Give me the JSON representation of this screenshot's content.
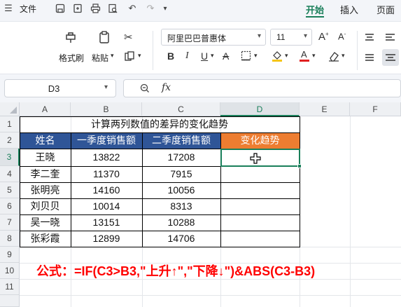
{
  "menu": {
    "file_label": "文件",
    "tabs": [
      "开始",
      "插入",
      "页面"
    ]
  },
  "ribbon": {
    "format_painter": "格式刷",
    "paste": "粘贴",
    "font_name": "阿里巴巴普惠体",
    "font_size": "11"
  },
  "formula_bar": {
    "cell_ref": "D3",
    "fx": "fx",
    "content": ""
  },
  "grid": {
    "columns": [
      "A",
      "B",
      "C",
      "D",
      "E",
      "F"
    ],
    "rows": [
      "1",
      "2",
      "3",
      "4",
      "5",
      "6",
      "7",
      "8",
      "9",
      "10",
      "11"
    ],
    "title": "计算两列数值的差异的变化趋势",
    "headers": [
      "姓名",
      "一季度销售额",
      "二季度销售额",
      "变化趋势"
    ],
    "data": [
      [
        "王晓",
        "13822",
        "17208",
        ""
      ],
      [
        "李二奎",
        "11370",
        "7915",
        ""
      ],
      [
        "张明亮",
        "14160",
        "10056",
        ""
      ],
      [
        "刘贝贝",
        "10014",
        "8313",
        ""
      ],
      [
        "吴一晓",
        "13151",
        "10288",
        ""
      ],
      [
        "张彩霞",
        "12899",
        "14706",
        ""
      ]
    ],
    "formula_note": "公式：=IF(C3>B3,\"上升↑\",\"下降↓\")&ABS(C3-B3)"
  },
  "colors": {
    "header_blue": "#2f5597",
    "trend_orange": "#ed7d31",
    "accent_green": "#1a7f5a",
    "formula_red": "#ff0000"
  }
}
